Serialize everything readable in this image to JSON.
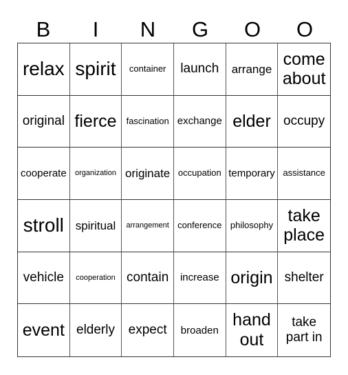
{
  "header": [
    "B",
    "I",
    "N",
    "G",
    "O",
    "O"
  ],
  "cells": [
    [
      "relax",
      "spirit",
      "container",
      "launch",
      "arrange",
      "come about"
    ],
    [
      "original",
      "fierce",
      "fascination",
      "exchange",
      "elder",
      "occupy"
    ],
    [
      "cooperate",
      "organization",
      "originate",
      "occupation",
      "temporary",
      "assistance"
    ],
    [
      "stroll",
      "spiritual",
      "arrangement",
      "conference",
      "philosophy",
      "take place"
    ],
    [
      "vehicle",
      "cooperation",
      "contain",
      "increase",
      "origin",
      "shelter"
    ],
    [
      "event",
      "elderly",
      "expect",
      "broaden",
      "hand out",
      "take part in"
    ]
  ]
}
